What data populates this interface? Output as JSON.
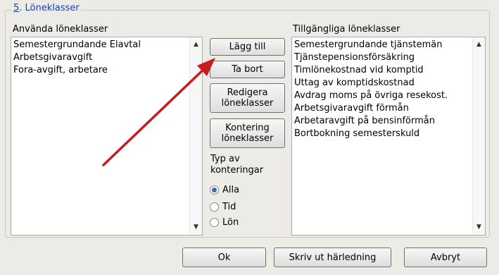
{
  "groupbox": {
    "number": "5",
    "title": ". Löneklasser"
  },
  "used": {
    "label": "Använda löneklasser",
    "items": [
      "Semestergrundande Elavtal",
      "Arbetsgivaravgift",
      "Fora-avgift, arbetare"
    ]
  },
  "available": {
    "label": "Tillgängliga löneklasser",
    "items": [
      "Semestergrundande tjänstemän",
      "Tjänstepensionsförsäkring",
      "Timlönekostnad vid komptid",
      "Uttag av komptidskostnad",
      "Avdrag moms på övriga resekost.",
      "Arbetsgivaravgift förmån",
      "Arbetaravgift på bensinförmån",
      "Bortbokning semesterskuld"
    ]
  },
  "buttons": {
    "add": "Lägg till",
    "remove": "Ta bort",
    "edit_classes": "Redigera\nlöneklasser",
    "posting_classes": "Kontering\nlöneklasser",
    "ok": "Ok",
    "print": "Skriv ut härledning",
    "cancel": "Avbryt"
  },
  "posting_type": {
    "label": "Typ av\nkonteringar",
    "options": [
      "Alla",
      "Tid",
      "Lön"
    ],
    "selected": "Alla"
  },
  "colors": {
    "group_title": "#1a3fb5",
    "annotation_arrow": "#c41e1e",
    "radio_dot": "#3167c9"
  }
}
